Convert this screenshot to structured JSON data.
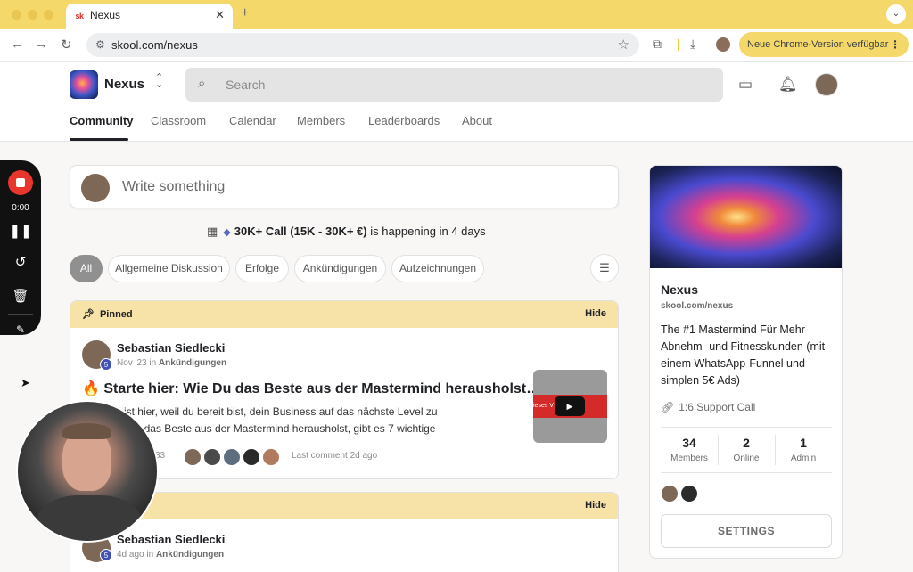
{
  "browser": {
    "tab_title": "Nexus",
    "tab_favicon": "sk",
    "url": "skool.com/nexus",
    "update_label": "Neue Chrome-Version verfügbar"
  },
  "header": {
    "group_name": "Nexus",
    "search_placeholder": "Search",
    "nav": [
      "Community",
      "Classroom",
      "Calendar",
      "Members",
      "Leaderboards",
      "About"
    ]
  },
  "recorder": {
    "time": "0:00"
  },
  "composer": {
    "placeholder": "Write something"
  },
  "event": {
    "title": "30K+ Call (15K - 30K+ €)",
    "suffix": " is happening in 4 days"
  },
  "filters": [
    "All",
    "Allgemeine Diskussion",
    "Erfolge",
    "Ankündigungen",
    "Aufzeichnungen"
  ],
  "posts": [
    {
      "pinned_label": "Pinned",
      "hide_label": "Hide",
      "author": "Sebastian Siedlecki",
      "level": "5",
      "time": "Nov '23",
      "in_word": "in",
      "category": "Ankündigungen",
      "title": "🔥 Starte hier: Wie Du das Beste aus der Mastermind herausholst…",
      "body_line1": "👋: Du bist hier, weil du bereit bist, dein Business auf das nächste Level zu",
      "body_line2": "⚠️ Damit du das Beste aus der Mastermind herausholst, gibt es 7 wichtige",
      "comment_count": "33",
      "last_comment": "Last comment 2d ago",
      "thumb_text": "ieses V… Pflich"
    },
    {
      "hide_label": "Hide",
      "author": "Sebastian Siedlecki",
      "level": "5",
      "time": "4d ago",
      "in_word": "in",
      "category": "Ankündigungen"
    }
  ],
  "sidebar": {
    "name": "Nexus",
    "url": "skool.com/nexus",
    "description": "The #1 Mastermind Für Mehr Abnehm- und Fitnesskunden (mit einem WhatsApp-Funnel und simplen 5€ Ads)",
    "link_label": "1:6 Support Call",
    "stats": [
      {
        "value": "34",
        "label": "Members"
      },
      {
        "value": "2",
        "label": "Online"
      },
      {
        "value": "1",
        "label": "Admin"
      }
    ],
    "settings_label": "SETTINGS"
  }
}
